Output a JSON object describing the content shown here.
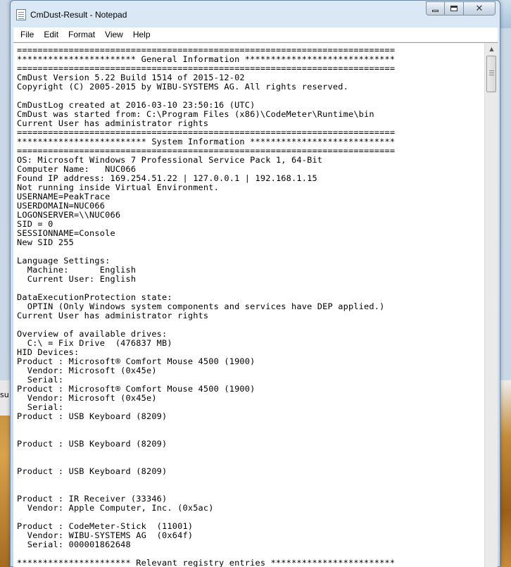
{
  "background": {
    "left_fragment_text": "su"
  },
  "window": {
    "title": "CmDust-Result - Notepad",
    "icon": "notepad-icon",
    "caption_buttons": [
      "minimize-icon",
      "maximize-icon",
      "close-icon"
    ]
  },
  "menu": {
    "items": [
      "File",
      "Edit",
      "Format",
      "View",
      "Help"
    ]
  },
  "document": {
    "lines": [
      "=========================================================================",
      "*********************** General Information *****************************",
      "=========================================================================",
      "CmDust Version 5.22 Build 1514 of 2015-12-02",
      "Copyright (C) 2005-2015 by WIBU-SYSTEMS AG. All rights reserved.",
      "",
      "CmDustLog created at 2016-03-10 23:50:16 (UTC)",
      "CmDust was started from: C:\\Program Files (x86)\\CodeMeter\\Runtime\\bin",
      "Current User has administrator rights",
      "=========================================================================",
      "************************* System Information ****************************",
      "=========================================================================",
      "OS: Microsoft Windows 7 Professional Service Pack 1, 64-Bit",
      "Computer Name:   NUC066",
      "Found IP address: 169.254.51.22 | 127.0.0.1 | 192.168.1.15",
      "Not running inside Virtual Environment.",
      "USERNAME=PeakTrace",
      "USERDOMAIN=NUC066",
      "LOGONSERVER=\\\\NUC066",
      "SID = 0",
      "SESSIONNAME=Console",
      "New SID 255",
      "",
      "Language Settings:",
      "  Machine:      English",
      "  Current User: English",
      "",
      "DataExecutionProtection state:",
      "  OPTIN (Only Windows system components and services have DEP applied.)",
      "Current User has administrator rights",
      "",
      "Overview of available drives:",
      "  C:\\ = Fix Drive  (476837 MB)",
      "HID Devices:",
      "Product : Microsoft® Comfort Mouse 4500 (1900)",
      "  Vendor: Microsoft (0x45e)",
      "  Serial:",
      "Product : Microsoft® Comfort Mouse 4500 (1900)",
      "  Vendor: Microsoft (0x45e)",
      "  Serial:",
      "Product : USB Keyboard (8209)",
      "",
      "",
      "Product : USB Keyboard (8209)",
      "",
      "",
      "Product : USB Keyboard (8209)",
      "",
      "",
      "Product : IR Receiver (33346)",
      "  Vendor: Apple Computer, Inc. (0x5ac)",
      "",
      "Product : CodeMeter-Stick  (11001)",
      "  Vendor: WIBU-SYSTEMS AG  (0x64f)",
      "  Serial: 000001862648",
      "",
      "********************** Relevant registry entries ************************"
    ]
  }
}
